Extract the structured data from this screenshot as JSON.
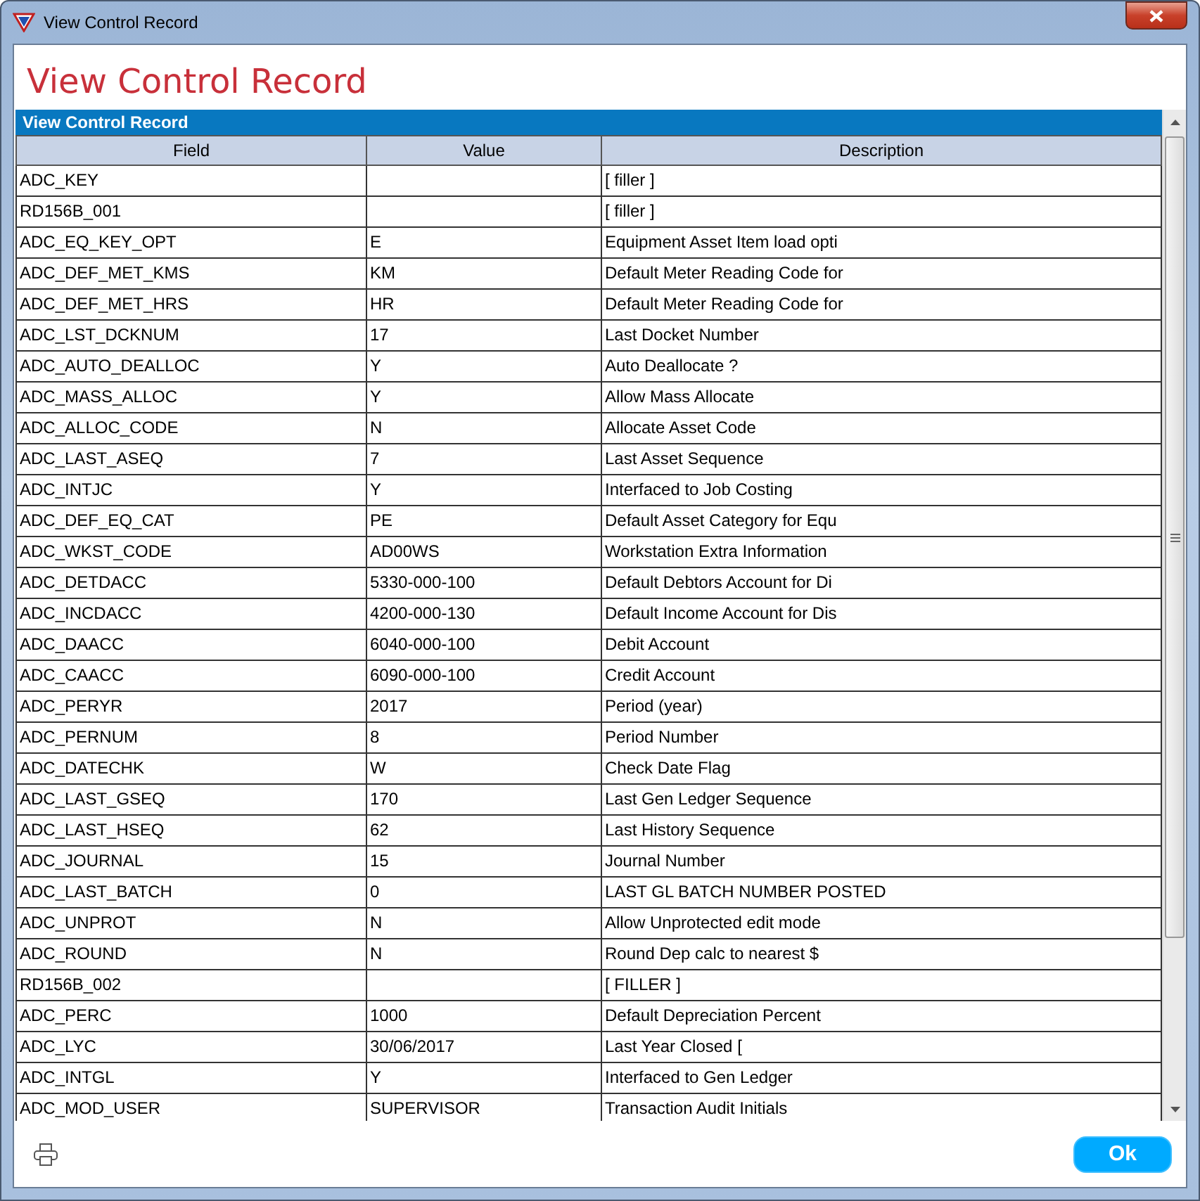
{
  "window": {
    "title": "View Control Record"
  },
  "heading": "View Control Record",
  "grid": {
    "title": "View Control Record",
    "columns": [
      "Field",
      "Value",
      "Description"
    ],
    "rows": [
      [
        "ADC_KEY",
        "",
        "[ filler ]"
      ],
      [
        "RD156B_001",
        "",
        "[ filler ]"
      ],
      [
        "ADC_EQ_KEY_OPT",
        "E",
        "Equipment Asset Item load opti"
      ],
      [
        "ADC_DEF_MET_KMS",
        "KM",
        "Default Meter Reading Code for"
      ],
      [
        "ADC_DEF_MET_HRS",
        "HR",
        "Default Meter Reading Code for"
      ],
      [
        "ADC_LST_DCKNUM",
        "17",
        "Last Docket Number"
      ],
      [
        "ADC_AUTO_DEALLOC",
        "Y",
        "Auto Deallocate ?"
      ],
      [
        "ADC_MASS_ALLOC",
        "Y",
        "Allow Mass Allocate"
      ],
      [
        "ADC_ALLOC_CODE",
        "N",
        "Allocate Asset Code"
      ],
      [
        "ADC_LAST_ASEQ",
        "7",
        "Last Asset Sequence"
      ],
      [
        "ADC_INTJC",
        "Y",
        "Interfaced to Job Costing"
      ],
      [
        "ADC_DEF_EQ_CAT",
        "PE",
        "Default Asset Category for Equ"
      ],
      [
        "ADC_WKST_CODE",
        "AD00WS",
        "Workstation Extra Information"
      ],
      [
        "ADC_DETDACC",
        "5330-000-100",
        "Default Debtors Account for Di"
      ],
      [
        "ADC_INCDACC",
        "4200-000-130",
        "Default Income Account for Dis"
      ],
      [
        "ADC_DAACC",
        "6040-000-100",
        "Debit Account"
      ],
      [
        "ADC_CAACC",
        "6090-000-100",
        "Credit Account"
      ],
      [
        "ADC_PERYR",
        "2017",
        "Period (year)"
      ],
      [
        "ADC_PERNUM",
        "8",
        "Period Number"
      ],
      [
        "ADC_DATECHK",
        "W",
        "Check Date Flag"
      ],
      [
        "ADC_LAST_GSEQ",
        "170",
        "Last Gen Ledger Sequence"
      ],
      [
        "ADC_LAST_HSEQ",
        "62",
        "Last History Sequence"
      ],
      [
        "ADC_JOURNAL",
        "15",
        "Journal Number"
      ],
      [
        "ADC_LAST_BATCH",
        "0",
        "LAST GL BATCH NUMBER POSTED"
      ],
      [
        "ADC_UNPROT",
        "N",
        "Allow Unprotected edit mode"
      ],
      [
        "ADC_ROUND",
        "N",
        "Round Dep calc to nearest $"
      ],
      [
        "RD156B_002",
        "",
        "[ FILLER ]"
      ],
      [
        "ADC_PERC",
        "1000",
        "Default Depreciation Percent"
      ],
      [
        "ADC_LYC",
        "30/06/2017",
        "Last Year Closed ["
      ],
      [
        "ADC_INTGL",
        "Y",
        "Interfaced to Gen Ledger"
      ],
      [
        "ADC_MOD_USER",
        "SUPERVISOR",
        "Transaction Audit Initials"
      ]
    ]
  },
  "buttons": {
    "ok": "Ok"
  }
}
